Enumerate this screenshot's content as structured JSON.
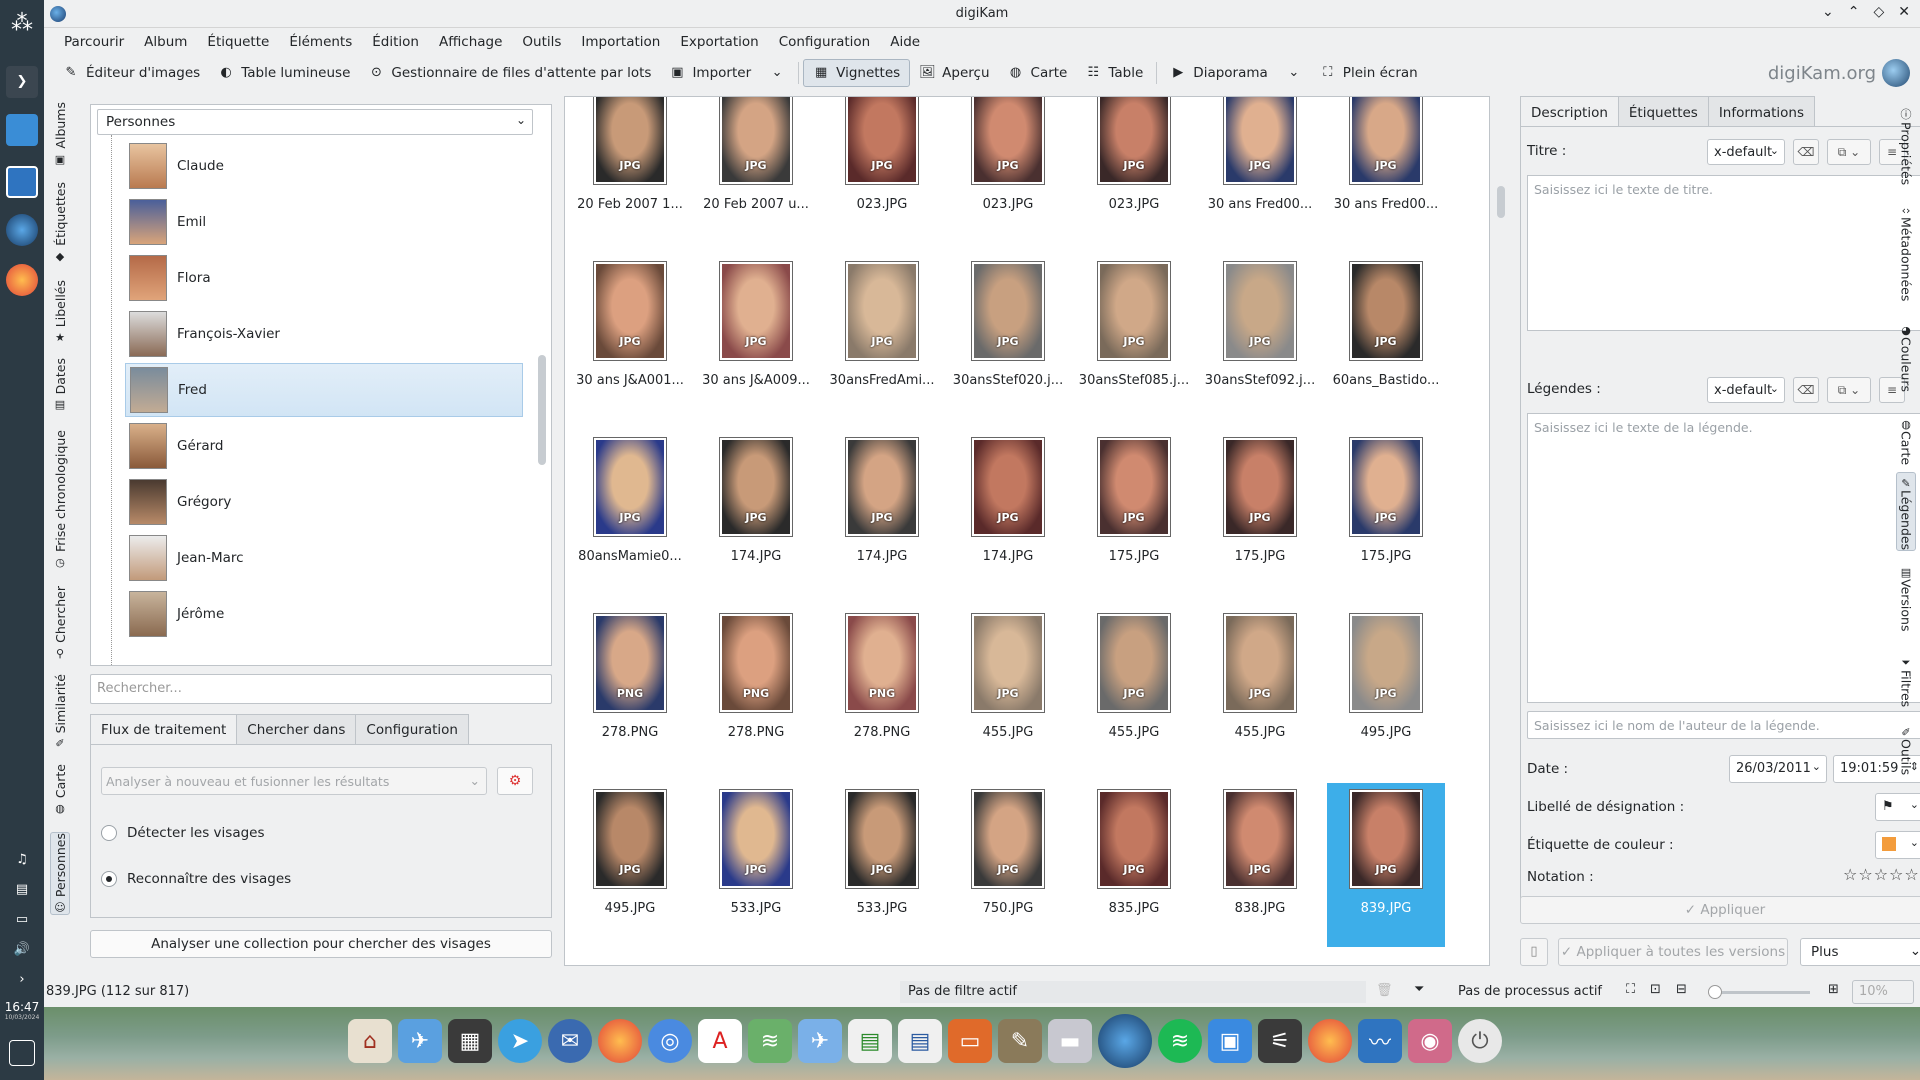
{
  "window": {
    "title": "digiKam"
  },
  "taskbar": {
    "time": "16:47",
    "date": "10/03/2024"
  },
  "menu": [
    "Parcourir",
    "Album",
    "Étiquette",
    "Éléments",
    "Édition",
    "Affichage",
    "Outils",
    "Importation",
    "Exportation",
    "Configuration",
    "Aide"
  ],
  "toolbar": {
    "image_editor": "Éditeur d'images",
    "light_table": "Table lumineuse",
    "batch_queue": "Gestionnaire de files d'attente par lots",
    "import": "Importer",
    "thumbnails": "Vignettes",
    "preview": "Aperçu",
    "map": "Carte",
    "table": "Table",
    "slideshow": "Diaporama",
    "fullscreen": "Plein écran",
    "brand": "digiKam.org"
  },
  "left_tabs": [
    "Albums",
    "Étiquettes",
    "Libellés",
    "Dates",
    "Frise chronologique",
    "Chercher",
    "Similarité",
    "Carte",
    "Personnes"
  ],
  "people": {
    "combo": "Personnes",
    "items": [
      "Claude",
      "Emil",
      "Flora",
      "François-Xavier",
      "Fred",
      "Gérard",
      "Grégory",
      "Jean-Marc",
      "Jérôme"
    ],
    "selected": "Fred",
    "search_placeholder": "Rechercher..."
  },
  "face_tabs": [
    "Flux de traitement",
    "Chercher dans",
    "Configuration"
  ],
  "face_workflow": {
    "reanalyze": "Analyser à nouveau et fusionner les résultats",
    "detect": "Détecter les visages",
    "recognize": "Reconnaître des visages",
    "scan_button": "Analyser une collection pour chercher des visages"
  },
  "thumbnails": [
    {
      "name": "20 Feb 2007 1...",
      "type": "JPG"
    },
    {
      "name": "20 Feb 2007 u...",
      "type": "JPG"
    },
    {
      "name": "023.JPG",
      "type": "JPG"
    },
    {
      "name": "023.JPG",
      "type": "JPG"
    },
    {
      "name": "023.JPG",
      "type": "JPG"
    },
    {
      "name": "30 ans Fred00...",
      "type": "JPG"
    },
    {
      "name": "30 ans Fred00...",
      "type": "JPG"
    },
    {
      "name": "30 ans J&A001...",
      "type": "JPG"
    },
    {
      "name": "30 ans J&A009...",
      "type": "JPG"
    },
    {
      "name": "30ansFredAmi...",
      "type": "JPG"
    },
    {
      "name": "30ansStef020.j...",
      "type": "JPG"
    },
    {
      "name": "30ansStef085.j...",
      "type": "JPG"
    },
    {
      "name": "30ansStef092.j...",
      "type": "JPG"
    },
    {
      "name": "60ans_Bastido...",
      "type": "JPG"
    },
    {
      "name": "80ansMamie0...",
      "type": "JPG"
    },
    {
      "name": "174.JPG",
      "type": "JPG"
    },
    {
      "name": "174.JPG",
      "type": "JPG"
    },
    {
      "name": "174.JPG",
      "type": "JPG"
    },
    {
      "name": "175.JPG",
      "type": "JPG"
    },
    {
      "name": "175.JPG",
      "type": "JPG"
    },
    {
      "name": "175.JPG",
      "type": "JPG"
    },
    {
      "name": "278.PNG",
      "type": "PNG"
    },
    {
      "name": "278.PNG",
      "type": "PNG"
    },
    {
      "name": "278.PNG",
      "type": "PNG"
    },
    {
      "name": "455.JPG",
      "type": "JPG"
    },
    {
      "name": "455.JPG",
      "type": "JPG"
    },
    {
      "name": "455.JPG",
      "type": "JPG"
    },
    {
      "name": "495.JPG",
      "type": "JPG"
    },
    {
      "name": "495.JPG",
      "type": "JPG"
    },
    {
      "name": "533.JPG",
      "type": "JPG"
    },
    {
      "name": "533.JPG",
      "type": "JPG"
    },
    {
      "name": "750.JPG",
      "type": "JPG"
    },
    {
      "name": "835.JPG",
      "type": "JPG"
    },
    {
      "name": "838.JPG",
      "type": "JPG"
    },
    {
      "name": "839.JPG",
      "type": "JPG"
    }
  ],
  "selected_thumbnail": "839.JPG",
  "right_tabs": [
    "Description",
    "Étiquettes",
    "Informations"
  ],
  "description": {
    "title_label": "Titre :",
    "title_lang": "x-default",
    "title_placeholder": "Saisissez ici le texte de titre.",
    "captions_label": "Légendes :",
    "captions_lang": "x-default",
    "captions_placeholder": "Saisissez ici le texte de la légende.",
    "author_placeholder": "Saisissez ici le nom de l'auteur de la légende.",
    "date_label": "Date :",
    "date_value": "26/03/2011",
    "time_value": "19:01:59",
    "pick_label": "Libellé de désignation :",
    "color_label": "Étiquette de couleur :",
    "rating_label": "Notation :",
    "apply": "Appliquer",
    "apply_all": "Appliquer à toutes les versions",
    "more": "Plus"
  },
  "right_vtabs": [
    "Propriétés",
    "Métadonnées",
    "Couleurs",
    "Carte",
    "Légendes",
    "Versions",
    "Filtres",
    "Outils"
  ],
  "status": {
    "left": "839.JPG (112 sur 817)",
    "filter": "Pas de filtre actif",
    "process": "Pas de processus actif",
    "zoom": "10%"
  },
  "colors": {
    "accent": "#3daee9",
    "selection": "#d2e5f5"
  }
}
